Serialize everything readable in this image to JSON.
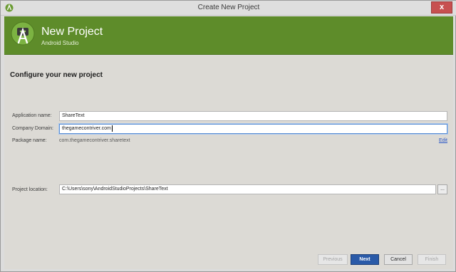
{
  "window": {
    "title": "Create New Project",
    "close_glyph": "x"
  },
  "header": {
    "title": "New Project",
    "subtitle": "Android Studio",
    "accent_color": "#5e8c2a"
  },
  "main": {
    "section_title": "Configure your new project",
    "application_name_label": "Application name:",
    "application_name_value": "ShareText",
    "company_domain_label": "Company Domain:",
    "company_domain_value": "thegamecontriver.com",
    "package_name_label": "Package name:",
    "package_name_value": "com.thegamecontriver.sharetext",
    "edit_label": "Edit",
    "project_location_label": "Project location:",
    "project_location_value": "C:\\Users\\sony\\AndroidStudioProjects\\ShareText",
    "browse_label": "..."
  },
  "footer": {
    "previous_label": "Previous",
    "next_label": "Next",
    "cancel_label": "Cancel",
    "finish_label": "Finish"
  },
  "icons": {
    "app": "android-studio-icon",
    "logo": "android-studio-logo-icon"
  }
}
